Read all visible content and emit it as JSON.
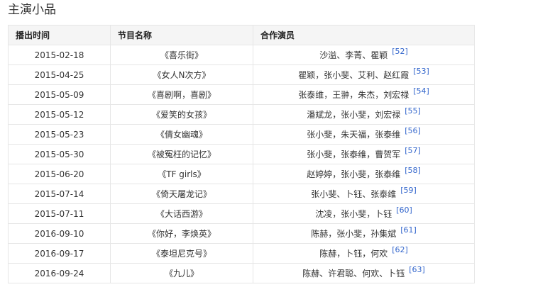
{
  "section": {
    "title": "主演小品"
  },
  "table": {
    "headers": [
      "播出时间",
      "节目名称",
      "合作演员"
    ],
    "rows": [
      {
        "date": "2015-02-18",
        "name": "《喜乐街》",
        "cast": "沙溢、李菁、瞿颖",
        "ref": "[52]"
      },
      {
        "date": "2015-04-25",
        "name": "《女人N次方》",
        "cast": "瞿颖，张小斐、艾利、赵红霞",
        "ref": "[53]"
      },
      {
        "date": "2015-05-09",
        "name": "《喜剧啊，喜剧》",
        "cast": "张泰维，王翀，朱杰，刘宏禄",
        "ref": "[54]"
      },
      {
        "date": "2015-05-12",
        "name": "《爱笑的女孩》",
        "cast": "潘斌龙，张小斐，刘宏禄",
        "ref": "[55]"
      },
      {
        "date": "2015-05-23",
        "name": "《倩女幽魂》",
        "cast": "张小斐，朱天福，张泰维",
        "ref": "[56]"
      },
      {
        "date": "2015-05-30",
        "name": "《被冤枉的记忆》",
        "cast": "张小斐，张泰维，曹贺军",
        "ref": "[57]"
      },
      {
        "date": "2015-06-20",
        "name": "《TF girls》",
        "cast": "赵婷婷，张小斐，张泰维",
        "ref": "[58]"
      },
      {
        "date": "2015-07-14",
        "name": "《倚天屠龙记》",
        "cast": "张小斐、卜钰、张泰维",
        "ref": "[59]"
      },
      {
        "date": "2015-07-11",
        "name": "《大话西游》",
        "cast": "沈凌，张小斐，卜钰",
        "ref": "[60]"
      },
      {
        "date": "2016-09-10",
        "name": "《你好，李焕英》",
        "cast": "陈赫，张小斐，孙集斌",
        "ref": "[61]"
      },
      {
        "date": "2016-09-17",
        "name": "《泰坦尼克号》",
        "cast": "陈赫，卜钰，何欢",
        "ref": "[62]"
      },
      {
        "date": "2016-09-24",
        "name": "《九儿》",
        "cast": "陈赫、许君聪、何欢、卜钰",
        "ref": "[63]"
      }
    ]
  }
}
